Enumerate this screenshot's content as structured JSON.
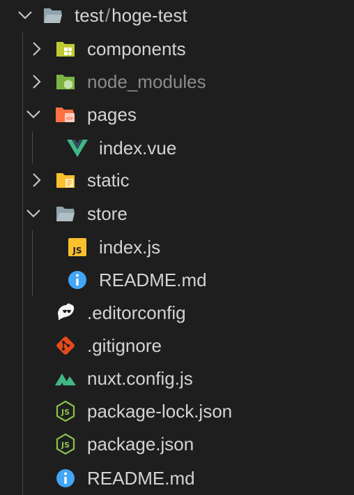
{
  "explorer": {
    "root": {
      "parent": "test",
      "separator": "/",
      "name": "hoge-test",
      "icon": "folder-open-icon",
      "expanded": true
    },
    "items": [
      {
        "label": "components",
        "type": "folder",
        "icon": "components-folder-icon",
        "expanded": false
      },
      {
        "label": "node_modules",
        "type": "folder",
        "icon": "node-modules-folder-icon",
        "expanded": false
      },
      {
        "label": "pages",
        "type": "folder",
        "icon": "pages-folder-icon",
        "expanded": true
      },
      {
        "label": "index.vue",
        "type": "file",
        "icon": "vue-icon"
      },
      {
        "label": "static",
        "type": "folder",
        "icon": "static-folder-icon",
        "expanded": false
      },
      {
        "label": "store",
        "type": "folder",
        "icon": "store-folder-icon",
        "expanded": true
      },
      {
        "label": "index.js",
        "type": "file",
        "icon": "js-icon"
      },
      {
        "label": "README.md",
        "type": "file",
        "icon": "info-icon"
      },
      {
        "label": ".editorconfig",
        "type": "file",
        "icon": "editorconfig-icon"
      },
      {
        "label": ".gitignore",
        "type": "file",
        "icon": "git-icon"
      },
      {
        "label": "nuxt.config.js",
        "type": "file",
        "icon": "nuxt-icon"
      },
      {
        "label": "package-lock.json",
        "type": "file",
        "icon": "nodejs-icon"
      },
      {
        "label": "package.json",
        "type": "file",
        "icon": "nodejs-icon"
      },
      {
        "label": "README.md",
        "type": "file",
        "icon": "info-icon"
      }
    ]
  },
  "colors": {
    "background": "#1e1e1e",
    "text": "#d4d4d4",
    "dim_text": "#8b8b8b",
    "chevron": "#c5c5c5",
    "guide": "#4a4a4a"
  }
}
